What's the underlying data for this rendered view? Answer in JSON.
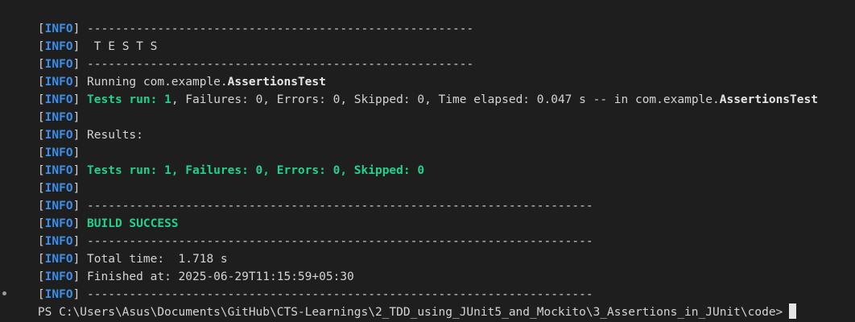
{
  "log": {
    "open_bracket": "[",
    "level": "INFO",
    "close_bracket": "]",
    "lines": [
      {
        "text": " -------------------------------------------------------"
      },
      {
        "text": "  T E S T S"
      },
      {
        "text": " -------------------------------------------------------"
      },
      {
        "prefix": " Running com.example.",
        "bold": "AssertionsTest"
      },
      {
        "green": " Tests run: 1",
        "text": ", Failures: 0, Errors: 0, Skipped: 0, Time elapsed: 0.047 s -- in com.example.",
        "bold": "AssertionsTest"
      },
      {
        "text": ""
      },
      {
        "text": " Results:"
      },
      {
        "text": ""
      },
      {
        "green": " Tests run: 1, Failures: 0, Errors: 0, Skipped: 0"
      },
      {
        "text": ""
      },
      {
        "text": " ------------------------------------------------------------------------"
      },
      {
        "green": " BUILD SUCCESS"
      },
      {
        "text": " ------------------------------------------------------------------------"
      },
      {
        "text": " Total time:  1.718 s"
      },
      {
        "text": " Finished at: 2025-06-29T11:15:59+05:30"
      },
      {
        "text": " ------------------------------------------------------------------------"
      }
    ]
  },
  "prompt": {
    "text": "PS C:\\Users\\Asus\\Documents\\GitHub\\CTS-Learnings\\2_TDD_using_JUnit5_and_Mockito\\3_Assertions_in_JUnit\\code>"
  },
  "colors": {
    "background": "#1e1e1e",
    "info_level": "#3b8eea",
    "success": "#23d18b",
    "text": "#d4d4d4"
  }
}
